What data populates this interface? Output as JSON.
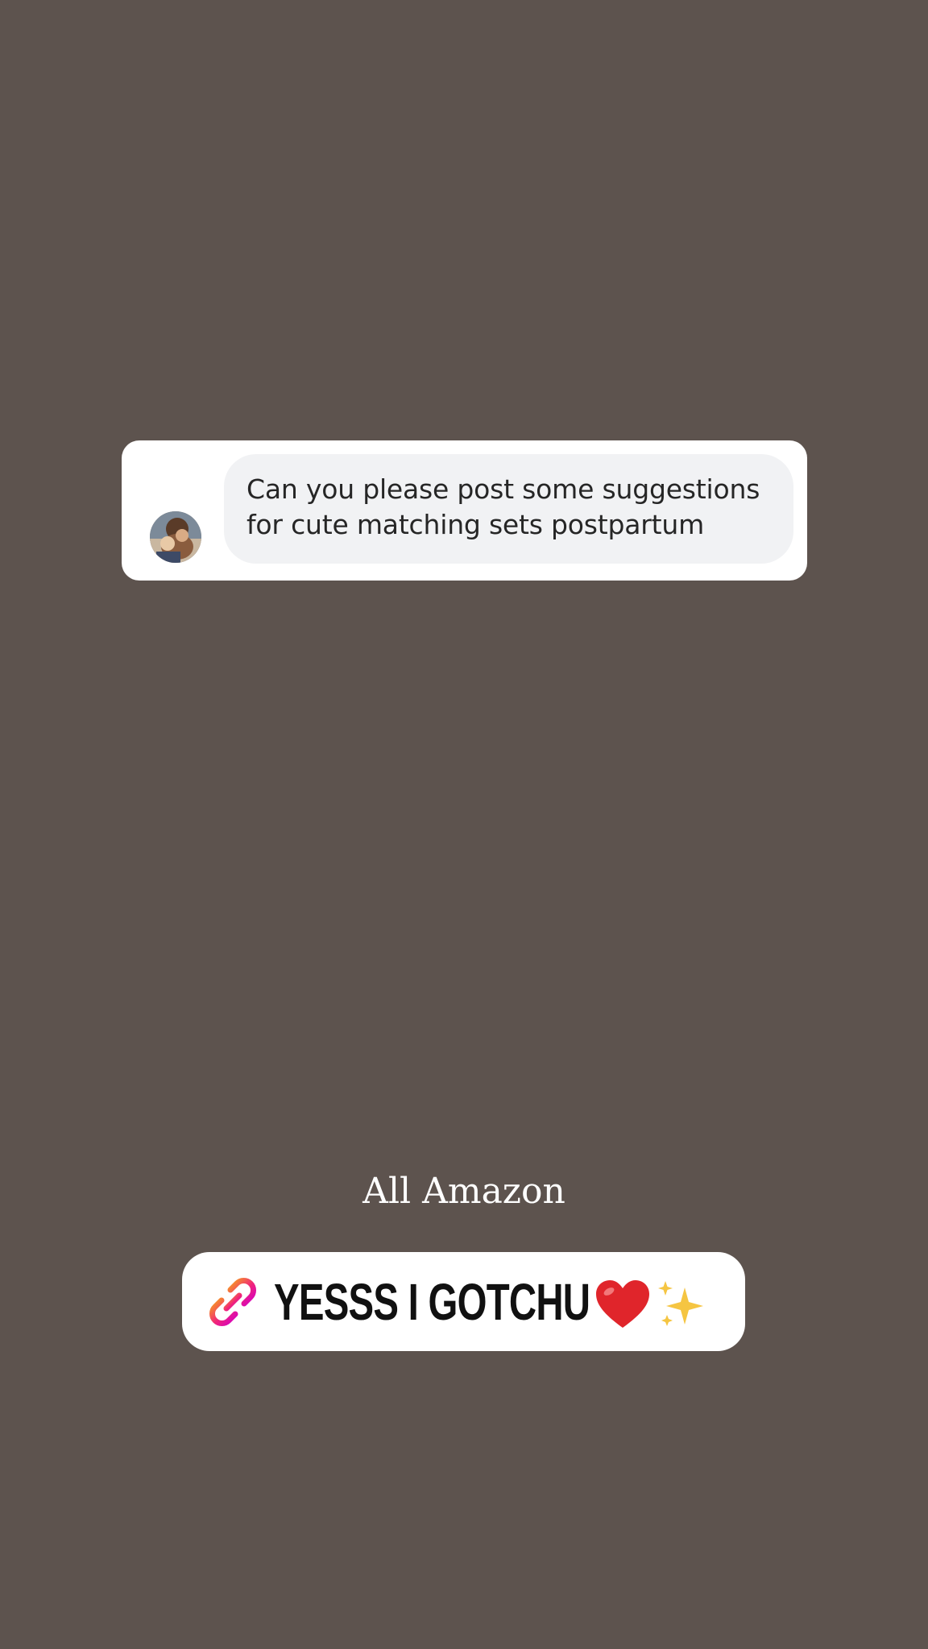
{
  "story": {
    "question": {
      "text": "Can you please post some suggestions for cute matching sets postpartum"
    },
    "caption": "All Amazon",
    "link_sticker": {
      "label": "YESSS I GOTCHU",
      "icons": [
        "link-icon",
        "heart-icon",
        "sparkles-icon"
      ]
    }
  },
  "colors": {
    "background": "#5d534e",
    "bubble": "#f1f2f4",
    "link_gradient_start": "#f7a21b",
    "link_gradient_end": "#d300c5",
    "heart": "#e0252b",
    "sparkles": "#f5c542"
  }
}
